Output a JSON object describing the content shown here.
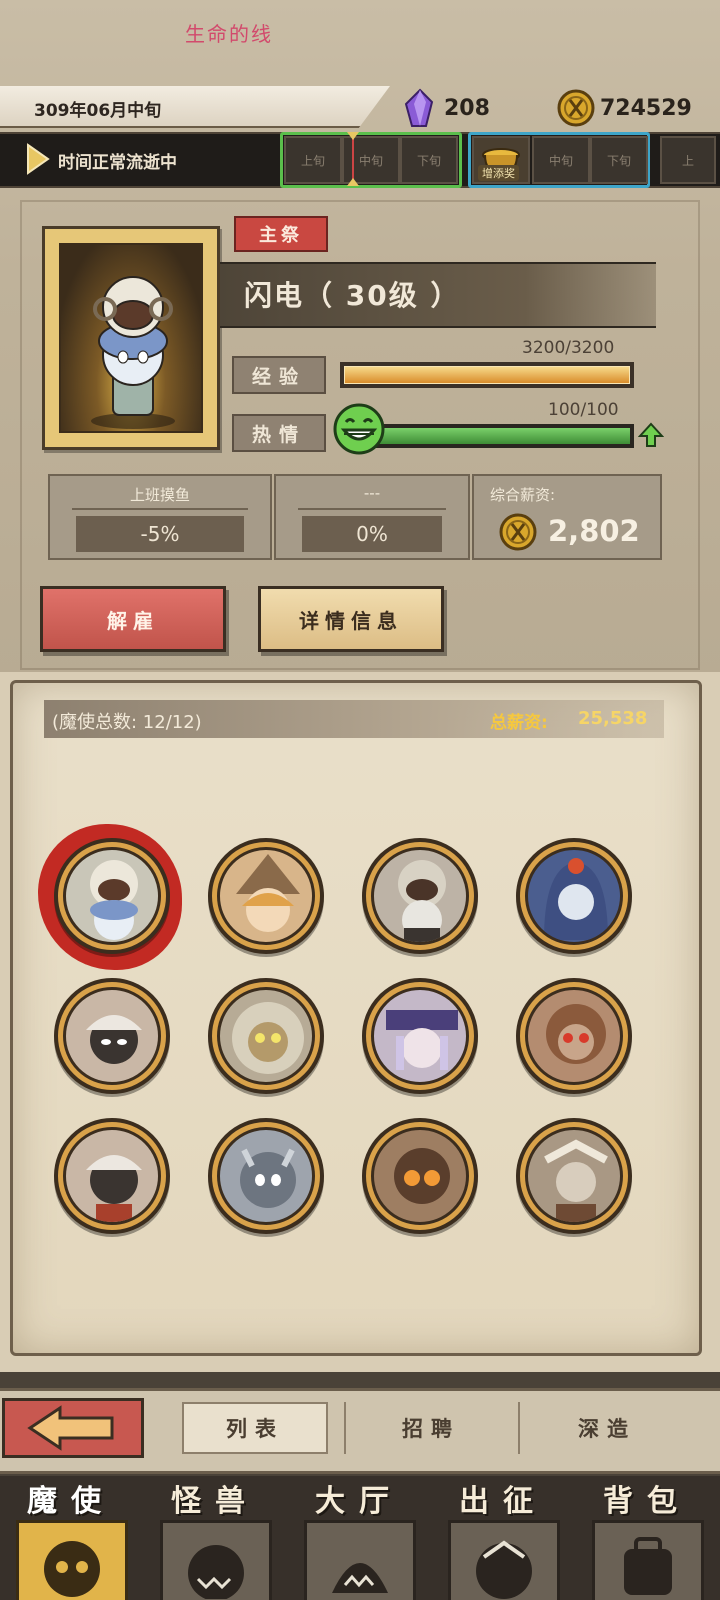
{
  "top_title": "生命的线",
  "header": {
    "date": "309年06月中旬",
    "crystals": "208",
    "gold": "724529"
  },
  "time_bar": {
    "status": "时间正常流逝中",
    "slots": [
      "上旬",
      "中旬",
      "下旬",
      "中旬",
      "下旬",
      "上"
    ],
    "bonus_label": "增添奖"
  },
  "character": {
    "role_tag": "主祭",
    "name": "闪电（ 30级 ）",
    "exp_label": "经验",
    "exp_value": "3200/3200",
    "exp_progress": 1.0,
    "passion_label": "热情",
    "passion_value": "100/100",
    "passion_progress": 1.0
  },
  "stats": {
    "slack_title": "上班摸鱼",
    "slack_value": "-5%",
    "unknown_title": "---",
    "unknown_value": "0%",
    "salary_title": "综合薪资:",
    "salary_value": "2,802"
  },
  "buttons": {
    "fire": "解雇",
    "detail": "详情信息"
  },
  "roster": {
    "count_label": "(魔使总数: 12/12)",
    "total_salary_label": "总薪资:",
    "total_salary_value": "25,538"
  },
  "subnav": {
    "tabs": [
      "列表",
      "招聘",
      "深造"
    ]
  },
  "mainnav": {
    "tabs": [
      "魔使",
      "怪兽",
      "大厅",
      "出征",
      "背包"
    ]
  },
  "colors": {
    "accent_red": "#c94841",
    "gold": "#f6c83e",
    "passion_green": "#3f8d36",
    "exp_orange": "#d98d2b"
  }
}
